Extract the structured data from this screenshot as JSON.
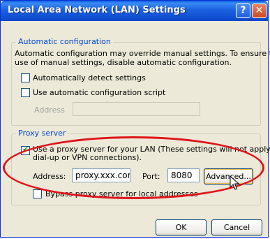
{
  "window": {
    "title": "Local Area Network (LAN) Settings",
    "help_label": "?",
    "close_label": "✕"
  },
  "auto_config": {
    "legend": "Automatic configuration",
    "desc_line1": "Automatic configuration may override manual settings.  To ensure the",
    "desc_line2": "use of manual settings, disable automatic configuration.",
    "auto_detect_label": "Automatically detect settings",
    "auto_detect_checked": false,
    "script_label": "Use automatic configuration script",
    "script_checked": false,
    "address_label": "Address",
    "address_value": ""
  },
  "proxy": {
    "legend": "Proxy server",
    "use_proxy_line1": "Use a proxy server for your LAN (These settings will not apply to",
    "use_proxy_line2": "dial-up or VPN connections).",
    "use_proxy_checked": true,
    "address_label": "Address:",
    "address_value": "proxy.xxx.com",
    "port_label": "Port:",
    "port_value": "8080",
    "advanced_label": "Advanced...",
    "bypass_label": "Bypass proxy server for local addresses",
    "bypass_checked": false
  },
  "buttons": {
    "ok_label": "OK",
    "cancel_label": "Cancel"
  },
  "colors": {
    "annotation": "#e0141a",
    "titlebar": "#0b46c9"
  },
  "icons": [
    "help-icon",
    "close-icon",
    "mouse-cursor-icon",
    "checkmark-icon"
  ]
}
